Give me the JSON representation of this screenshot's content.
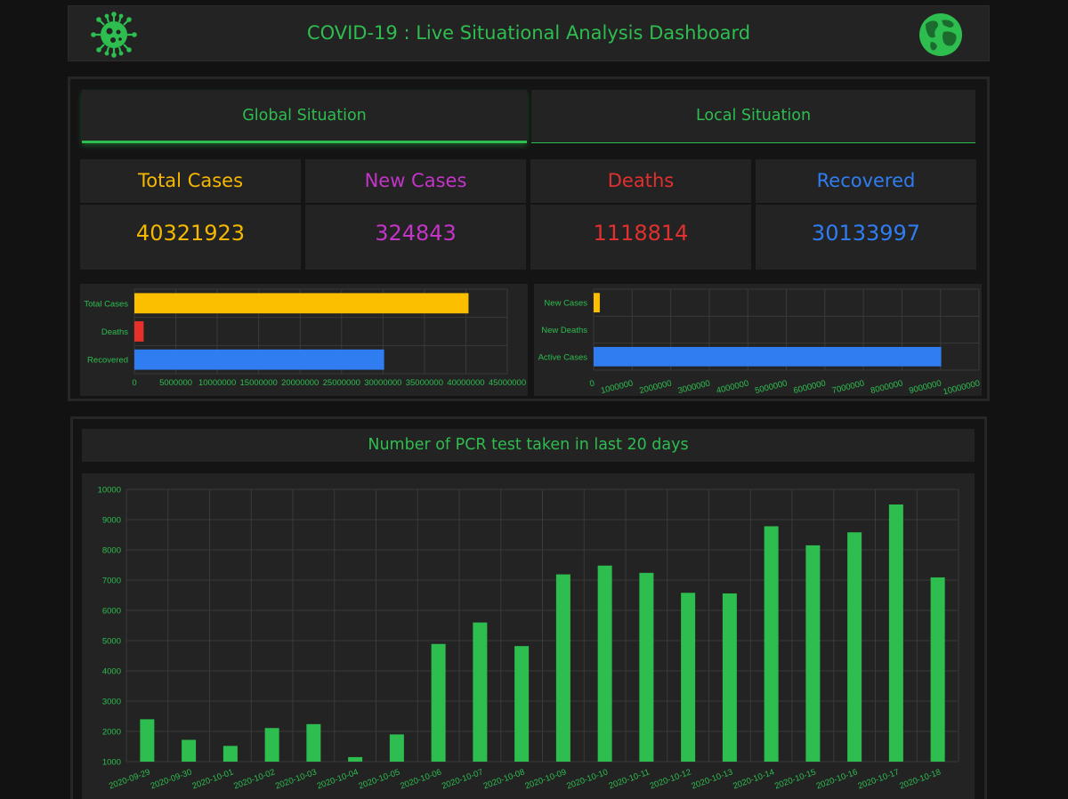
{
  "header": {
    "title": "COVID-19 : Live Situational Analysis Dashboard",
    "left_icon": "virus-icon",
    "right_icon": "globe-icon"
  },
  "tabs": {
    "global": "Global Situation",
    "local": "Local Situation"
  },
  "stats": {
    "total_cases": {
      "label": "Total Cases",
      "value": "40321923",
      "color": "#f5b800"
    },
    "new_cases": {
      "label": "New Cases",
      "value": "324843",
      "color": "#c334c7"
    },
    "deaths": {
      "label": "Deaths",
      "value": "1118814",
      "color": "#e0302f"
    },
    "recovered": {
      "label": "Recovered",
      "value": "30133997",
      "color": "#2f7df0"
    }
  },
  "chart_data": [
    {
      "type": "bar",
      "orientation": "horizontal",
      "categories": [
        "Total Cases",
        "Deaths",
        "Recovered"
      ],
      "values": [
        40321923,
        1118814,
        30133997
      ],
      "colors": [
        "#fcbf00",
        "#e8302b",
        "#2f7df0"
      ],
      "xlim": [
        0,
        45000000
      ],
      "xticks": [
        "0",
        "5000000",
        "10000000",
        "15000000",
        "20000000",
        "25000000",
        "30000000",
        "35000000",
        "40000000",
        "45000000"
      ],
      "grid": true
    },
    {
      "type": "bar",
      "orientation": "horizontal",
      "categories": [
        "New Cases",
        "New Deaths",
        "Active Cases"
      ],
      "values": [
        160000,
        0,
        9020000
      ],
      "colors": [
        "#fcbf00",
        "#e8302b",
        "#2f7df0"
      ],
      "xlim": [
        0,
        10000000
      ],
      "xticks": [
        "0",
        "1000000",
        "2000000",
        "3000000",
        "4000000",
        "5000000",
        "6000000",
        "7000000",
        "8000000",
        "9000000",
        "10000000"
      ],
      "grid": true
    },
    {
      "type": "bar",
      "title": "Number of PCR test taken in last 20 days",
      "categories": [
        "2020-09-29",
        "2020-09-30",
        "2020-10-01",
        "2020-10-02",
        "2020-10-03",
        "2020-10-04",
        "2020-10-05",
        "2020-10-06",
        "2020-10-07",
        "2020-10-08",
        "2020-10-09",
        "2020-10-10",
        "2020-10-11",
        "2020-10-12",
        "2020-10-13",
        "2020-10-14",
        "2020-10-15",
        "2020-10-16",
        "2020-10-17",
        "2020-10-18"
      ],
      "values": [
        2400,
        1720,
        1520,
        2110,
        2240,
        1150,
        1900,
        4890,
        5600,
        4820,
        7190,
        7480,
        7240,
        6580,
        6560,
        8780,
        8150,
        8580,
        9500,
        7090
      ],
      "color": "#2ebd4f",
      "ylim": [
        1000,
        10000
      ],
      "yticks": [
        "1000",
        "2000",
        "3000",
        "4000",
        "5000",
        "6000",
        "7000",
        "8000",
        "9000",
        "10000"
      ],
      "grid": true
    }
  ]
}
